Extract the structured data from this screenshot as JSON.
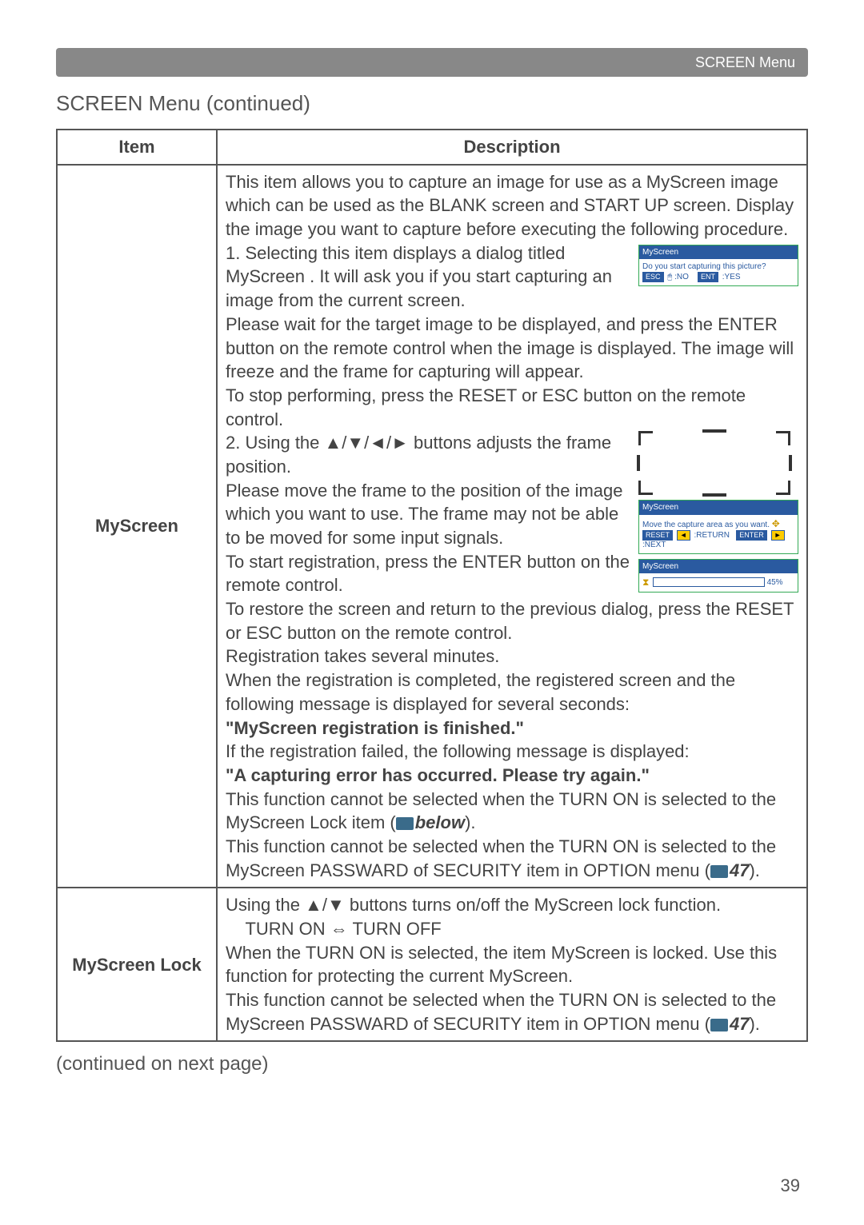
{
  "header": {
    "breadcrumb": "SCREEN Menu"
  },
  "section": {
    "title": "SCREEN Menu (continued)"
  },
  "table": {
    "head": {
      "item": "Item",
      "desc": "Description"
    },
    "row1": {
      "item": "MyScreen",
      "intro": "This item allows you to capture an image for use as a MyScreen image which can be used as the BLANK screen and START UP screen. Display the image you want to capture before executing the following procedure.",
      "step1a": "1. Selecting this item displays a dialog titled  MyScreen . It will ask you if you start capturing an image from the current screen.",
      "step1b": "Please wait for the target image to be displayed, and press the ENTER button on the remote control when the image is displayed. The image will freeze and the frame for capturing will appear.",
      "step1c": "To stop performing, press the RESET or ESC button on the remote control.",
      "step2a": "2. Using the ▲/▼/◄/► buttons adjusts the frame position.",
      "step2b": "Please move the frame to the position of the image which you want to use. The frame may not be able to be moved for some input signals.",
      "step2c": "To start registration, press the ENTER button on the remote control.",
      "step2d": "To restore the screen and return to the previous dialog, press the RESET or ESC button on the remote control.",
      "reg1": "Registration takes several minutes.",
      "reg2": "When the registration is completed, the registered screen and the following message is displayed for several seconds:",
      "msg_ok": "\"MyScreen registration is finished.\"",
      "reg3": "If the registration failed, the following message is displayed:",
      "msg_err": "\"A capturing error has occurred. Please try again.\"",
      "note1a": " This function cannot be selected when the TURN ON is selected to the MyScreen Lock item (",
      "note1b": "below",
      "note1c": ").",
      "note2a": " This function cannot be selected when the TURN ON is selected to the MyScreen PASSWARD of SECURITY item in OPTION menu (",
      "note2b": "47",
      "note2c": ")."
    },
    "row2": {
      "item": "MyScreen Lock",
      "line1": "Using the ▲/▼ buttons turns on/off the MyScreen lock function.",
      "line2": "TURN ON ⇔ TURN OFF",
      "line3": "When the TURN ON is selected, the item MyScreen is locked. Use this function for protecting the current MyScreen.",
      "note_a": " This function cannot be selected when the TURN ON is selected to the MyScreen PASSWARD of SECURITY item in OPTION menu (",
      "note_b": "47",
      "note_c": ")."
    }
  },
  "dialogs": {
    "d1": {
      "title": "MyScreen",
      "body": "Do you start capturing this picture?",
      "esc": "ESC",
      "no": ":NO",
      "ent": "ENT",
      "yes": ":YES"
    },
    "d2": {
      "title": "MyScreen",
      "body": "Move the capture area\nas you want.",
      "reset": "RESET",
      "return": ":RETURN",
      "enter": "ENTER",
      "next": ":NEXT"
    },
    "d3": {
      "title": "MyScreen",
      "pct": "45%"
    }
  },
  "footer": {
    "continued": "(continued on next page)",
    "page": "39"
  }
}
